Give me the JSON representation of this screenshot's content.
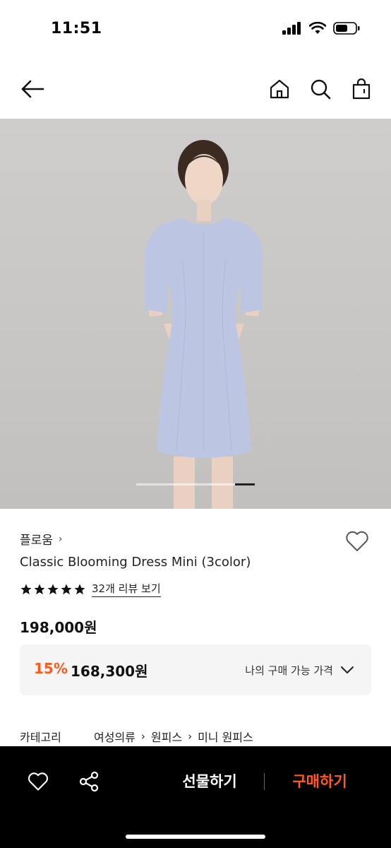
{
  "status_bar": {
    "time": "11:51"
  },
  "header": {
    "back_icon": "arrow-left-icon",
    "home_icon": "home-icon",
    "search_icon": "search-icon",
    "cart_icon": "shopping-bag-icon"
  },
  "carousel": {
    "current_slide_fraction": 1.0
  },
  "product": {
    "brand": "플로움",
    "brand_chevron": "›",
    "title": "Classic Blooming Dress Mini (3color)",
    "rating_stars": 5,
    "review_link": "32개 리뷰 보기",
    "original_price": "198,000원",
    "my_price": {
      "discount": "15%",
      "sale_price": "168,300원",
      "label": "나의 구매 가능 가격"
    },
    "category": {
      "label": "카테고리",
      "path": [
        "여성의류",
        "원피스",
        "미니 원피스"
      ]
    }
  },
  "bottom_bar": {
    "gift_label": "선물하기",
    "buy_label": "구매하기"
  },
  "colors": {
    "accent": "#ff5a1f",
    "bottom_bar_bg": "#000000",
    "price_box_bg": "#f5f5f5",
    "photo_bg": "#c9c7c5",
    "dress": "#bcc6e2"
  }
}
